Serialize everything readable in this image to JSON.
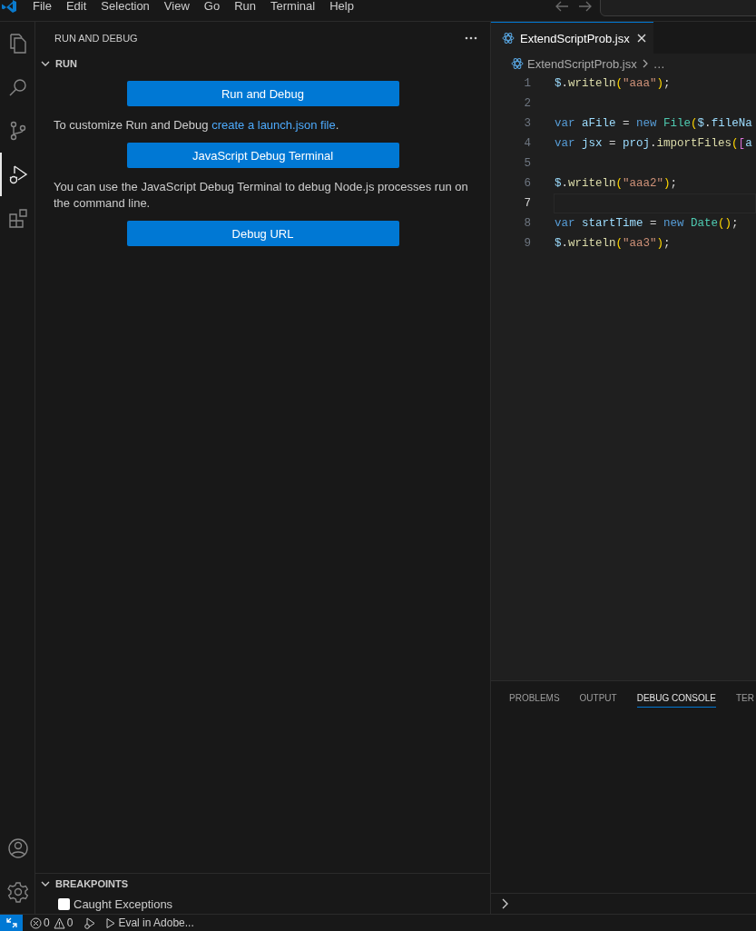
{
  "menu_bar": {
    "items": [
      "File",
      "Edit",
      "Selection",
      "View",
      "Go",
      "Run",
      "Terminal",
      "Help"
    ]
  },
  "activity_bar": {
    "items": [
      {
        "kind": "explorer",
        "selected": false
      },
      {
        "kind": "search",
        "selected": false
      },
      {
        "kind": "source-control",
        "selected": false
      },
      {
        "kind": "run-debug",
        "selected": true
      },
      {
        "kind": "extensions",
        "selected": false
      }
    ],
    "bottom": [
      {
        "kind": "account"
      },
      {
        "kind": "settings"
      }
    ]
  },
  "sidebar": {
    "title": "RUN AND DEBUG",
    "sections": [
      {
        "title": "RUN",
        "expanded": true,
        "content": [
          {
            "kind": "button",
            "label": "Run and Debug"
          },
          {
            "kind": "text",
            "text": "To customize Run and Debug ",
            "link": "create a launch.json file",
            "after": "."
          },
          {
            "kind": "button",
            "label": "JavaScript Debug Terminal"
          },
          {
            "kind": "text",
            "text": "You can use the JavaScript Debug Terminal to debug Node.js processes run on the command line."
          },
          {
            "kind": "button",
            "label": "Debug URL"
          }
        ]
      }
    ],
    "breakpoints": {
      "title": "BREAKPOINTS",
      "expanded": true,
      "items": [
        {
          "label": "Caught Exceptions",
          "checked": false
        }
      ]
    }
  },
  "editor": {
    "tabs": [
      {
        "label": "ExtendScriptProb.jsx",
        "selected": true
      }
    ],
    "breadcrumb": [
      "ExtendScriptProb.jsx",
      "…"
    ],
    "lines": [
      {
        "number": "1",
        "current": false,
        "tokens": [
          {
            "text": "$",
            "kind": "variable"
          },
          {
            "text": ".",
            "kind": "plain"
          },
          {
            "text": "writeln",
            "kind": "function"
          },
          {
            "text": "(",
            "kind": "bracket"
          },
          {
            "text": "\"aaa\"",
            "kind": "string"
          },
          {
            "text": ")",
            "kind": "bracket"
          },
          {
            "text": ";",
            "kind": "plain"
          }
        ]
      },
      {
        "number": "2",
        "current": false
      },
      {
        "number": "3",
        "current": false,
        "tokens": [
          {
            "text": "var ",
            "kind": "keyword"
          },
          {
            "text": "aFile",
            "kind": "variable"
          },
          {
            "text": " = ",
            "kind": "plain"
          },
          {
            "text": "new ",
            "kind": "keyword"
          },
          {
            "text": "File",
            "kind": "class"
          },
          {
            "text": "(",
            "kind": "bracket"
          },
          {
            "text": "$",
            "kind": "variable"
          },
          {
            "text": ".",
            "kind": "plain"
          },
          {
            "text": "fileNa",
            "kind": "variable"
          }
        ]
      },
      {
        "number": "4",
        "current": false,
        "tokens": [
          {
            "text": "var ",
            "kind": "keyword"
          },
          {
            "text": "jsx",
            "kind": "variable"
          },
          {
            "text": " = ",
            "kind": "plain"
          },
          {
            "text": "proj",
            "kind": "variable"
          },
          {
            "text": ".",
            "kind": "plain"
          },
          {
            "text": "importFiles",
            "kind": "function"
          },
          {
            "text": "(",
            "kind": "bracket"
          },
          {
            "text": "[",
            "kind": "bracket2"
          },
          {
            "text": "a",
            "kind": "variable"
          }
        ]
      },
      {
        "number": "5",
        "current": false
      },
      {
        "number": "6",
        "current": false,
        "tokens": [
          {
            "text": "$",
            "kind": "variable"
          },
          {
            "text": ".",
            "kind": "plain"
          },
          {
            "text": "writeln",
            "kind": "function"
          },
          {
            "text": "(",
            "kind": "bracket"
          },
          {
            "text": "\"aaa2\"",
            "kind": "string"
          },
          {
            "text": ")",
            "kind": "bracket"
          },
          {
            "text": ";",
            "kind": "plain"
          }
        ]
      },
      {
        "number": "7",
        "current": true
      },
      {
        "number": "8",
        "current": false,
        "tokens": [
          {
            "text": "var ",
            "kind": "keyword"
          },
          {
            "text": "startTime",
            "kind": "variable"
          },
          {
            "text": " = ",
            "kind": "plain"
          },
          {
            "text": "new ",
            "kind": "keyword"
          },
          {
            "text": "Date",
            "kind": "class"
          },
          {
            "text": "()",
            "kind": "bracket"
          },
          {
            "text": ";",
            "kind": "plain"
          }
        ]
      },
      {
        "number": "9",
        "current": false,
        "tokens": [
          {
            "text": "$",
            "kind": "variable"
          },
          {
            "text": ".",
            "kind": "plain"
          },
          {
            "text": "writeln",
            "kind": "function"
          },
          {
            "text": "(",
            "kind": "bracket"
          },
          {
            "text": "\"aa3\"",
            "kind": "string"
          },
          {
            "text": ")",
            "kind": "bracket"
          },
          {
            "text": ";",
            "kind": "plain"
          }
        ]
      }
    ]
  },
  "panel": {
    "tabs": [
      {
        "label": "PROBLEMS",
        "selected": false
      },
      {
        "label": "OUTPUT",
        "selected": false
      },
      {
        "label": "DEBUG CONSOLE",
        "selected": true
      },
      {
        "label": "TER",
        "selected": false
      }
    ]
  },
  "status_bar": {
    "errors": "0",
    "warnings": "0",
    "eval": "Eval in Adobe..."
  }
}
